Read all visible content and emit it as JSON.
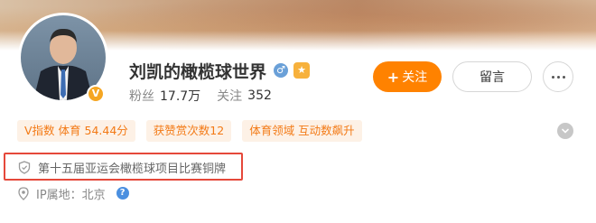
{
  "profile": {
    "name": "刘凯的橄榄球世界",
    "gender_icon": "male-icon",
    "level_icon": "level-badge-icon",
    "verified_badge": "V",
    "stats": {
      "fans_label": "粉丝",
      "fans_value": "17.7万",
      "following_label": "关注",
      "following_value": "352"
    }
  },
  "actions": {
    "follow_label": "关注",
    "follow_plus": "+",
    "message_label": "留言"
  },
  "tags": [
    "V指数 体育 54.44分",
    "获赞赏次数12",
    "体育领域 互动数飙升"
  ],
  "honor": {
    "text": "第十五届亚运会橄榄球项目比赛铜牌"
  },
  "ip": {
    "text": "IP属地：北京"
  },
  "colors": {
    "accent": "#ff8200",
    "tag_bg": "#fdf1e6",
    "tag_text": "#f37a16",
    "highlight_border": "#e5483a"
  }
}
